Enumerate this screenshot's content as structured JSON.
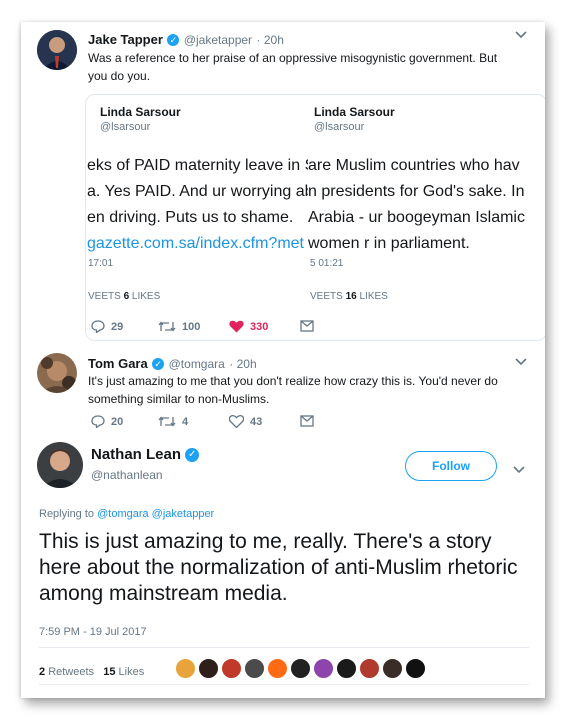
{
  "tweet1": {
    "name": "Jake Tapper",
    "handle": "@jaketapper",
    "time": "· 20h",
    "text_line1": "Was a reference to her praise of an oppressive misogynistic government.  But",
    "text_line2": "you do you.",
    "actions": {
      "replies": "29",
      "retweets": "100",
      "likes": "330"
    }
  },
  "quote_left": {
    "name": "Linda Sarsour",
    "handle": "@lsarsour",
    "lines": [
      "eks of PAID maternity leave in S",
      "a. Yes PAID. And ur worrying ab",
      "en driving. Puts us to shame."
    ],
    "link": "gazette.com.sa/index.cfm?met",
    "time": "17:01",
    "stats_label_a": "VEETS",
    "stats_num": "6",
    "stats_label_b": "LIKES"
  },
  "quote_right": {
    "name": "Linda Sarsour",
    "handle": "@lsarsour",
    "lines": [
      "are Muslim countries who hav",
      "n presidents for God's sake. In",
      "Arabia - ur boogeyman Islamic",
      "women r in parliament."
    ],
    "time": "5 01:21",
    "stats_label_a": "VEETS",
    "stats_num": "16",
    "stats_label_b": "LIKES"
  },
  "tweet2": {
    "name": "Tom Gara",
    "handle": "@tomgara",
    "time": "· 20h",
    "text_line1": "It's just amazing to me that you don't realize how crazy this is. You'd never do",
    "text_line2": "something similar to non-Muslims.",
    "actions": {
      "replies": "20",
      "retweets": "4",
      "likes": "43"
    }
  },
  "main_tweet": {
    "name": "Nathan Lean",
    "handle": "@nathanlean",
    "follow_label": "Follow",
    "replying_prefix": "Replying to",
    "replying_handles": "@tomgara @jaketapper",
    "text": "This is just amazing to me, really. There's a story here about the normalization of anti-Muslim rhetoric among mainstream media.",
    "timestamp": "7:59 PM - 19 Jul 2017",
    "retweets_num": "2",
    "retweets_label": "Retweets",
    "likes_num": "15",
    "likes_label": "Likes"
  },
  "colors": {
    "accent": "#1da1f2",
    "like_red": "#e0245e",
    "muted": "#657786"
  },
  "icons": [
    "verified-icon",
    "chevron-down-icon",
    "reply-icon",
    "retweet-icon",
    "heart-icon",
    "message-icon"
  ]
}
